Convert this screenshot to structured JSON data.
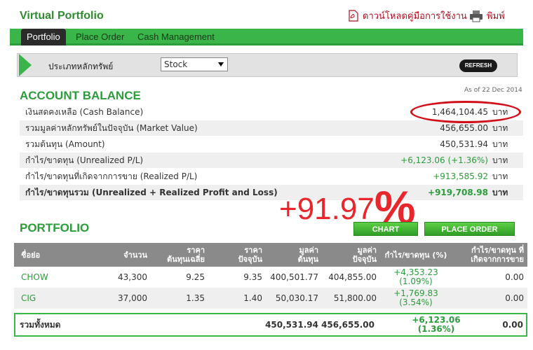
{
  "header": {
    "title": "Virtual Portfolio",
    "manual_link": "ดาวน์โหลดคู่มือการใช้งาน",
    "print_link": "พิมพ์",
    "pdf_icon": "pdf-icon",
    "print_icon": "printer-icon"
  },
  "nav": {
    "tabs": [
      "Portfolio",
      "Place Order",
      "Cash Management"
    ],
    "active": "Portfolio"
  },
  "filter": {
    "label": "ประเภทหลักทรัพย์",
    "selected": "Stock",
    "refresh_label": "REFRESH"
  },
  "account_balance": {
    "title": "ACCOUNT BALANCE",
    "as_of": "As of 22 Dec 2014",
    "unit": "บาท",
    "rows": [
      {
        "label": "เงินสดคงเหลือ (Cash Balance)",
        "value": "1,464,104.45"
      },
      {
        "label": "รวมมูลค่าหลักทรัพย์ในปัจจุบัน (Market Value)",
        "value": "456,655.00"
      },
      {
        "label": "รวมต้นทุน (Amount)",
        "value": "450,531.94"
      },
      {
        "label": "กำไร/ขาดทุน (Unrealized P/L)",
        "value": "+6,123.06 (+1.36%)"
      },
      {
        "label": "กำไร/ขาดทุนที่เกิดจากการขาย (Realized P/L)",
        "value": "+913,585.92"
      },
      {
        "label": "กำไร/ขาดทุนรวม (Unrealized + Realized Profit and Loss)",
        "value": "+919,708.98"
      }
    ],
    "annotation_number": "+91.97",
    "annotation_symbol": "%"
  },
  "portfolio": {
    "title": "PORTFOLIO",
    "chart_button": "CHART",
    "place_order_button": "PLACE ORDER",
    "columns": [
      "ชื่อย่อ",
      "จำนวน",
      "ราคา\nต้นทุนเฉลี่ย",
      "ราคา\nปัจจุบัน",
      "มูลค่า\nต้นทุน",
      "มูลค่า\nปัจจุบัน",
      "กำไร/ขาดทุน (%)",
      "กำไร/ขาดทุน ที่\nเกิดจากการขาย"
    ],
    "rows": [
      {
        "symbol": "CHOW",
        "qty": "43,300",
        "avg_cost": "9.25",
        "price": "9.35",
        "cost_value": "400,501.77",
        "market_value": "404,855.00",
        "gl": "+4,353.23",
        "gl_pct": "(1.09%)",
        "realized": "0.00"
      },
      {
        "symbol": "CIG",
        "qty": "37,000",
        "avg_cost": "1.35",
        "price": "1.40",
        "cost_value": "50,030.17",
        "market_value": "51,800.00",
        "gl": "+1,769.83",
        "gl_pct": "(3.54%)",
        "realized": "0.00"
      }
    ],
    "total": {
      "label": "รวมทั้งหมด",
      "cost_value": "450,531.94",
      "market_value": "456,655.00",
      "gl": "+6,123.06",
      "gl_pct": "(1.36%)",
      "realized": "0.00"
    }
  },
  "colors": {
    "brand_green": "#39b54a",
    "title_green": "#2a9d3a",
    "annotation_red": "#e8262b"
  }
}
